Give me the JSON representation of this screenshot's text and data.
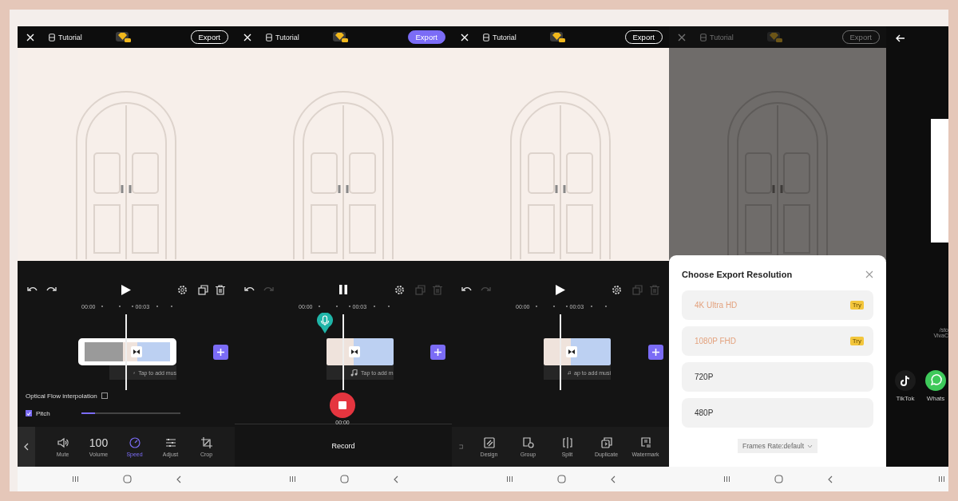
{
  "screens": [
    {
      "kind": "editor",
      "title": "Tutorial",
      "export": {
        "label": "Export",
        "highlighted": false
      },
      "dimmed": false,
      "playing": false,
      "redo_enabled": true,
      "clip_tools_enabled": true,
      "ticks": [
        "00:00",
        "00:03"
      ],
      "clip_selected": true,
      "music_hint": "Tap to add mus",
      "mic_marker": false,
      "panel": {
        "kind": "speed",
        "options": [
          {
            "kind": "checkbox",
            "label": "Optical Flow interpolation",
            "checked": false
          },
          {
            "kind": "checkbox_slider",
            "label": "Pitch",
            "checked": true,
            "level": 0.14
          }
        ]
      },
      "bottom": {
        "kind": "tools",
        "back": true,
        "items": [
          {
            "kind": "speaker",
            "label": "Mute",
            "selected": false
          },
          {
            "kind": "value",
            "value": "100",
            "label": "Volume",
            "selected": false
          },
          {
            "kind": "speed",
            "label": "Speed",
            "selected": true
          },
          {
            "kind": "sliders",
            "label": "Adjust",
            "selected": false
          },
          {
            "kind": "crop",
            "label": "Crop",
            "selected": false
          }
        ]
      }
    },
    {
      "kind": "editor",
      "title": "Tutorial",
      "export": {
        "label": "Export",
        "highlighted": true
      },
      "dimmed": false,
      "playing": true,
      "redo_enabled": false,
      "clip_tools_enabled": false,
      "ticks": [
        "00:00",
        "00:03"
      ],
      "clip_selected": false,
      "music_hint": "Tap to add m",
      "mic_marker": true,
      "panel": {
        "kind": "record",
        "time": "00:00"
      },
      "bottom": {
        "kind": "record",
        "label": "Record"
      }
    },
    {
      "kind": "editor",
      "title": "Tutorial",
      "export": {
        "label": "Export",
        "highlighted": false
      },
      "dimmed": false,
      "playing": false,
      "redo_enabled": false,
      "clip_tools_enabled": false,
      "ticks": [
        "00:00",
        "00:03"
      ],
      "clip_selected": false,
      "music_hint": "ap to add musi",
      "mic_marker": false,
      "panel": {
        "kind": "none"
      },
      "bottom": {
        "kind": "tools",
        "back": false,
        "items": [
          {
            "kind": "bracket",
            "selected": false
          },
          {
            "kind": "design",
            "label": "Design",
            "selected": false
          },
          {
            "kind": "group",
            "label": "Group",
            "selected": false
          },
          {
            "kind": "split",
            "label": "Split",
            "selected": false
          },
          {
            "kind": "duplicate",
            "label": "Duplicate",
            "selected": false
          },
          {
            "kind": "watermark",
            "label": "Watermark",
            "selected": false
          }
        ]
      }
    },
    {
      "kind": "editor",
      "title": "Tutorial",
      "export": {
        "label": "Export",
        "highlighted": false
      },
      "dimmed": true,
      "dialog": {
        "title": "Choose Export Resolution",
        "options": [
          {
            "label": "4K Ultra HD",
            "locked": true,
            "badge": "Try"
          },
          {
            "label": "1080P FHD",
            "locked": true,
            "badge": "Try"
          },
          {
            "label": "720P",
            "locked": false
          },
          {
            "label": "480P",
            "locked": false
          }
        ],
        "frame_rate": "Frames Rate:default"
      }
    },
    {
      "kind": "share",
      "path_lines": [
        "/sto",
        "VivaC"
      ],
      "apps": [
        {
          "kind": "tiktok",
          "label": "TikTok"
        },
        {
          "kind": "whatsapp",
          "label": "Whats"
        }
      ]
    }
  ]
}
